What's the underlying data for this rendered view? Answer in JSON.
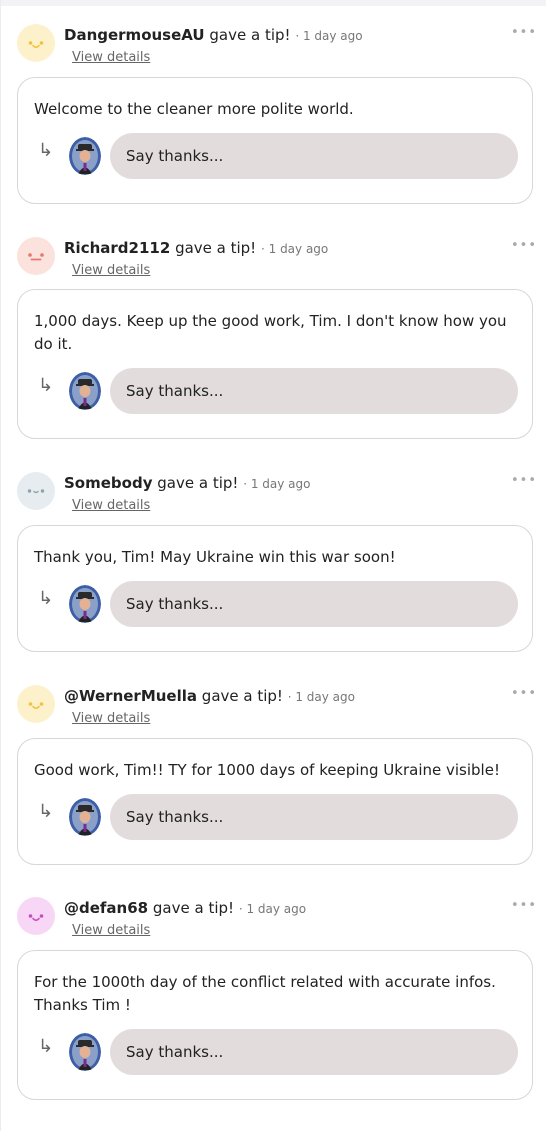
{
  "feed": {
    "tips": [
      {
        "name": "DangermouseAU",
        "action": "gave a tip!",
        "time": "· 1 day ago",
        "details_label": "View details",
        "message": "Welcome to the cleaner more polite world.",
        "reply_placeholder": "Say thanks...",
        "avatar_color": "#fdf1cc",
        "avatar_face_color": "#f2c23d",
        "avatar_face": "smile"
      },
      {
        "name": "Richard2112",
        "action": "gave a tip!",
        "time": "· 1 day ago",
        "details_label": "View details",
        "message": "1,000 days. Keep up the good work, Tim. I don't know how you do it.",
        "reply_placeholder": "Say thanks...",
        "avatar_color": "#fbe2dc",
        "avatar_face_color": "#e27a68",
        "avatar_face": "flat"
      },
      {
        "name": "Somebody",
        "action": "gave a tip!",
        "time": "· 1 day ago",
        "details_label": "View details",
        "message": "Thank you, Tim! May Ukraine win this war soon!",
        "reply_placeholder": "Say thanks...",
        "avatar_color": "#e6ecef",
        "avatar_face_color": "#8fa3ad",
        "avatar_face": "small"
      },
      {
        "name": "@WernerMuella",
        "action": "gave a tip!",
        "time": "· 1 day ago",
        "details_label": "View details",
        "message": "Good work, Tim!! TY for 1000 days of keeping Ukraine visible!",
        "reply_placeholder": "Say thanks...",
        "avatar_color": "#fdf1cc",
        "avatar_face_color": "#f2c23d",
        "avatar_face": "smile"
      },
      {
        "name": "@defan68",
        "action": "gave a tip!",
        "time": "· 1 day ago",
        "details_label": "View details",
        "message": "For the 1000th day of the conflict related with accurate infos. Thanks Tim !",
        "reply_placeholder": "Say thanks...",
        "avatar_color": "#f8d6f6",
        "avatar_face_color": "#c44fc4",
        "avatar_face": "smile"
      }
    ]
  },
  "icons": {
    "more": "more-options-icon",
    "reply": "reply-arrow-icon",
    "self_avatar": "user-avatar"
  }
}
